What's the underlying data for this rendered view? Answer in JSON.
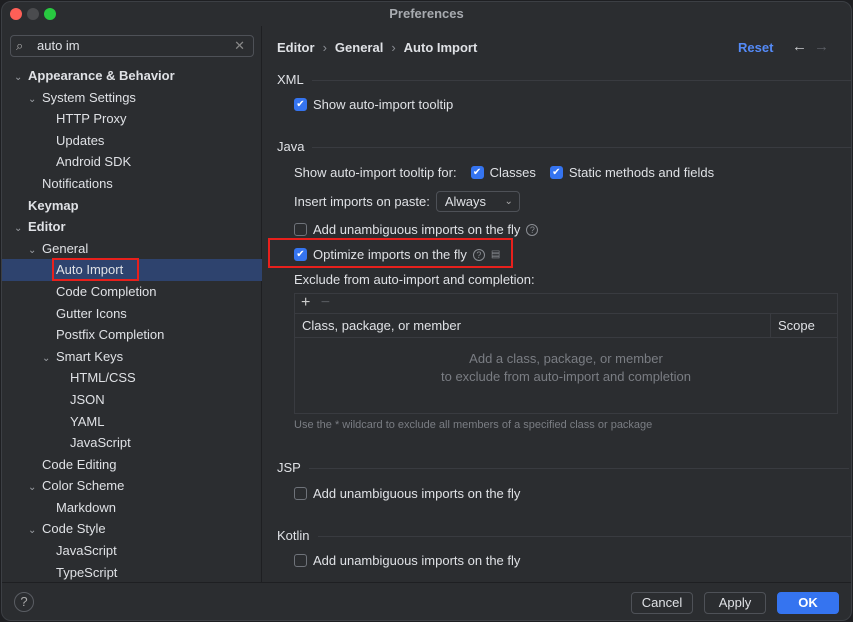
{
  "window": {
    "title": "Preferences"
  },
  "search": {
    "value": "auto im"
  },
  "tree": [
    {
      "label": "Appearance & Behavior",
      "level": 0,
      "chev": "⌄",
      "bold": true
    },
    {
      "label": "System Settings",
      "level": 1,
      "chev": "⌄"
    },
    {
      "label": "HTTP Proxy",
      "level": 2
    },
    {
      "label": "Updates",
      "level": 2
    },
    {
      "label": "Android SDK",
      "level": 2
    },
    {
      "label": "Notifications",
      "level": 1
    },
    {
      "label": "Keymap",
      "level": 0,
      "bold": true
    },
    {
      "label": "Editor",
      "level": 0,
      "chev": "⌄",
      "bold": true
    },
    {
      "label": "General",
      "level": 1,
      "chev": "⌄"
    },
    {
      "label": "Auto Import",
      "level": 2,
      "selected": true
    },
    {
      "label": "Code Completion",
      "level": 2
    },
    {
      "label": "Gutter Icons",
      "level": 2
    },
    {
      "label": "Postfix Completion",
      "level": 2
    },
    {
      "label": "Smart Keys",
      "level": 2,
      "chev": "⌄"
    },
    {
      "label": "HTML/CSS",
      "level": 3
    },
    {
      "label": "JSON",
      "level": 3
    },
    {
      "label": "YAML",
      "level": 3
    },
    {
      "label": "JavaScript",
      "level": 3
    },
    {
      "label": "Code Editing",
      "level": 1
    },
    {
      "label": "Color Scheme",
      "level": 1,
      "chev": "⌄"
    },
    {
      "label": "Markdown",
      "level": 2
    },
    {
      "label": "Code Style",
      "level": 1,
      "chev": "⌄"
    },
    {
      "label": "JavaScript",
      "level": 2
    },
    {
      "label": "TypeScript",
      "level": 2
    }
  ],
  "breadcrumb": [
    "Editor",
    "General",
    "Auto Import"
  ],
  "reset_label": "Reset",
  "xml": {
    "title": "XML",
    "show_tooltip": {
      "label": "Show auto-import tooltip",
      "checked": true
    }
  },
  "java": {
    "title": "Java",
    "tooltip_for": "Show auto-import tooltip for:",
    "classes": {
      "label": "Classes",
      "checked": true
    },
    "static": {
      "label": "Static methods and fields",
      "checked": true
    },
    "insert_label": "Insert imports on paste:",
    "insert_value": "Always",
    "unambiguous": {
      "label": "Add unambiguous imports on the fly",
      "checked": false
    },
    "optimize": {
      "label": "Optimize imports on the fly",
      "checked": true
    },
    "exclude_label": "Exclude from auto-import and completion:",
    "col_class": "Class, package, or member",
    "col_scope": "Scope",
    "empty1": "Add a class, package, or member",
    "empty2": "to exclude from auto-import and completion",
    "hint": "Use the * wildcard to exclude all members of a specified class or package"
  },
  "jsp": {
    "title": "JSP",
    "unambiguous": {
      "label": "Add unambiguous imports on the fly",
      "checked": false
    }
  },
  "kotlin": {
    "title": "Kotlin",
    "unambiguous": {
      "label": "Add unambiguous imports on the fly",
      "checked": false
    }
  },
  "footer": {
    "help": "?",
    "cancel": "Cancel",
    "apply": "Apply",
    "ok": "OK"
  },
  "colors": {
    "accent": "#3574f0",
    "selection": "#2e436e",
    "highlight": "#e8201c"
  }
}
